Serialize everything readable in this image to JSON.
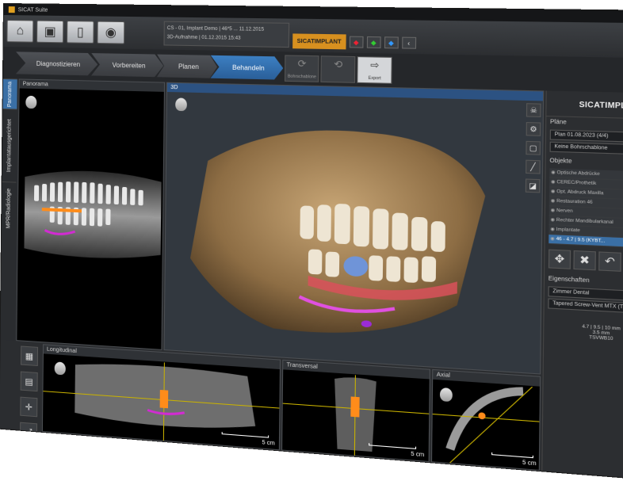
{
  "app": {
    "title": "SICAT Suite"
  },
  "toolbar": {
    "home_icon": "home-icon",
    "patient_line1": "CS - 01, Implant Demo | 46*5 ... 11.12.2015",
    "patient_line2": "3D-Aufnahme | 01.12.2015 15:43",
    "brand": "SICATIMPLANT"
  },
  "workflow": {
    "steps": [
      "Diagnostizieren",
      "Vorbereiten",
      "Planen",
      "Behandeln"
    ],
    "active_step": "Behandeln",
    "sub_buttons": [
      {
        "label": "Bohrschablone",
        "icon": "drill-template-icon"
      },
      {
        "label": "Export",
        "icon": "export-icon"
      }
    ]
  },
  "left_tabs": [
    "Panorama",
    "Implantatausgerichtet",
    "MPR/Radiologie"
  ],
  "views": {
    "panorama": {
      "title": "Panorama"
    },
    "v3d": {
      "title": "3D"
    },
    "longitudinal": {
      "title": "Longitudinal",
      "scale": "5 cm"
    },
    "transversal": {
      "title": "Transversal",
      "scale": "5 cm"
    },
    "axial": {
      "title": "Axial",
      "scale": "5 cm"
    }
  },
  "right_panel": {
    "logo": "SICATIMPLANT",
    "plans_header": "Pläne",
    "plan_value": "Plan 01.08.2023 (4/4)",
    "template_value": "Keine Bohrschablone",
    "objects_header": "Objekte",
    "objects": [
      {
        "label": "Optische Abdrücke",
        "highlight": false
      },
      {
        "label": "CEREC/Prothetik",
        "highlight": false
      },
      {
        "label": "Opt. Abdruck Maxilla",
        "highlight": false
      },
      {
        "label": "Restauration 46",
        "highlight": false
      },
      {
        "label": "Nerven",
        "highlight": false
      },
      {
        "label": "Rechter Mandibularkanal",
        "highlight": false
      },
      {
        "label": "Implantate",
        "highlight": false
      },
      {
        "label": "46 - 4.7 | 9.5 (KYBT...",
        "highlight": true
      }
    ],
    "props_header": "Eigenschaften",
    "manufacturer": "Zimmer Dental",
    "implant_model": "Tapered Screw-Vent MTX (TSVT)",
    "dims_line1": "4.7 | 9.5 | 10 mm",
    "dims_line2": "3.5 mm",
    "dims_line3": "TSVWB10"
  }
}
